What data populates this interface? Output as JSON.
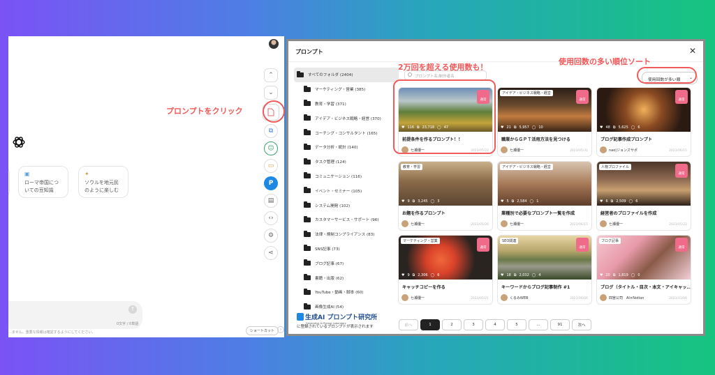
{
  "annotations": {
    "click_prompt": "プロンプトをクリック",
    "usage_count": "2万回を超える使用数も！",
    "sort": "使用回数の多い順位ソート"
  },
  "chat": {
    "suggestions": [
      {
        "label": "ローマ帝国につ\nいての豆知識"
      },
      {
        "label": "ソウルを地元民\nのように楽しむ"
      }
    ],
    "char_count": "0文字 / 0単語",
    "disclaimer": "...ません。重要な情報は確認するようにしてください。",
    "shortcut_label": "ショートカット"
  },
  "modal": {
    "title": "プロンプト",
    "search_placeholder": "プロンプト名/制作者名",
    "sort_value": "使用回数が多い順",
    "folders": [
      {
        "label": "すべてのフォルダ (2404)",
        "selected": true,
        "sub": false
      },
      {
        "label": "マーケティング・営業 (385)",
        "selected": false,
        "sub": true
      },
      {
        "label": "教育・学習 (371)",
        "selected": false,
        "sub": true
      },
      {
        "label": "アイデア・ビジネス戦略・経営 (370)",
        "selected": false,
        "sub": true
      },
      {
        "label": "コーチング・コンサルタント (165)",
        "selected": false,
        "sub": true
      },
      {
        "label": "データ分析・統計 (140)",
        "selected": false,
        "sub": true
      },
      {
        "label": "タスク管理 (124)",
        "selected": false,
        "sub": true
      },
      {
        "label": "コミュニケーション (116)",
        "selected": false,
        "sub": true
      },
      {
        "label": "イベント・セミナー (105)",
        "selected": false,
        "sub": true
      },
      {
        "label": "システム開発 (102)",
        "selected": false,
        "sub": true
      },
      {
        "label": "カスタマーサービス・サポート (96)",
        "selected": false,
        "sub": true
      },
      {
        "label": "法律・規制コンプライアンス (83)",
        "selected": false,
        "sub": true
      },
      {
        "label": "SNS記事 (73)",
        "selected": false,
        "sub": true
      },
      {
        "label": "ブログ記事 (67)",
        "selected": false,
        "sub": true
      },
      {
        "label": "書籍・出版 (62)",
        "selected": false,
        "sub": true
      },
      {
        "label": "YouTube・動画・脚本 (60)",
        "selected": false,
        "sub": true
      },
      {
        "label": "画像生成AI (54)",
        "selected": false,
        "sub": true
      }
    ],
    "lab_name": "生成AI プロンプト研究所",
    "lab_sub": "Generative AI Prompt Laboratory",
    "lab_note": "に登録されているプロンプトが表示されます",
    "cards": [
      {
        "tag": "",
        "badge": "通常",
        "likes": "116",
        "uses": "23,718",
        "comments": "47",
        "title": "前提条件を作るプロンプト！！",
        "author": "七瀬優一",
        "date": "2023/05/22",
        "bg": "linear-gradient(180deg,#6d8fb5 0%,#b9c7c9 30%,#5f7e3a 55%,#c3a43a 80%,#6b5a2a 100%)"
      },
      {
        "tag": "アイデア・ビジネス戦略・経営",
        "badge": "通常",
        "likes": "21",
        "uses": "5,957",
        "comments": "10",
        "title": "職業からＧＰＴ活用方法を見つける",
        "author": "七瀬優一",
        "date": "2023/05/31",
        "bg": "linear-gradient(180deg,#2b1d16 0%,#6a4a2f 40%,#c27b3e 65%,#3a2418 100%)"
      },
      {
        "tag": "",
        "badge": "通常",
        "likes": "48",
        "uses": "5,625",
        "comments": "6",
        "title": "ブログ記事作成プロンプト",
        "author": "nao|ジョンズサポ",
        "date": "2023/06/15",
        "bg": "radial-gradient(circle at 50% 50%,#f0b05a 0%,#8a4a22 35%,#2a1a12 75%)"
      },
      {
        "tag": "教育・学習",
        "badge": "",
        "likes": "9",
        "uses": "3,245",
        "comments": "3",
        "title": "お題を作るプロンプト",
        "author": "七瀬優一",
        "date": "2023/05/26",
        "bg": "linear-gradient(180deg,#c9b08a 0%,#8a6a48 45%,#5a4432 100%)"
      },
      {
        "tag": "アイデア・ビジネス戦略・経営",
        "badge": "",
        "likes": "5",
        "uses": "2,584",
        "comments": "1",
        "title": "業種別で必要なプロンプト一覧を作成",
        "author": "七瀬優一",
        "date": "2023/06/15",
        "bg": "linear-gradient(180deg,#d9c4b0 0%,#a77a58 50%,#5f3d2a 100%)"
      },
      {
        "tag": "人物プロファイル",
        "badge": "通常",
        "likes": "6",
        "uses": "2,509",
        "comments": "6",
        "title": "経営者のプロファイルを作成",
        "author": "七瀬優一",
        "date": "2023/05/22",
        "bg": "linear-gradient(180deg,#4a3428 0%,#8e6a52 40%,#c8a070 65%,#2e2018 100%)"
      },
      {
        "tag": "マーケティング・営業",
        "badge": "通常",
        "likes": "9",
        "uses": "2,306",
        "comments": "6",
        "title": "キャッチコピーを作る",
        "author": "七瀬優一",
        "date": "2023/05/21",
        "bg": "radial-gradient(circle at 45% 55%,#f0683a 0%,#d9422a 25%,#2a2420 60%)"
      },
      {
        "tag": "SEO関連",
        "badge": "通常",
        "likes": "18",
        "uses": "2,032",
        "comments": "4",
        "title": "キーワードからブログ記事制作 #1",
        "author": "くるみWEB",
        "date": "2023/06/06",
        "bg": "linear-gradient(180deg,#e8d6a6 0%,#b7a66a 35%,#6a7a4a 55%,#9a9a8a 70%,#3a4a2a 100%)"
      },
      {
        "tag": "ブログ記事",
        "badge": "通常",
        "likes": "20",
        "uses": "1,819",
        "comments": "0",
        "title": "ブログ（タイトル・目次・本文・アイキャッ...",
        "author": "四宮公司　AI×Notion",
        "date": "2023/11/06",
        "bg": "linear-gradient(135deg,#f4c8d0 0%,#e89aaa 35%,#8a5a48 60%,#f2d0d8 100%)"
      }
    ],
    "pagination": [
      "前へ",
      "1",
      "2",
      "3",
      "4",
      "5",
      "...",
      "91",
      "次へ"
    ]
  }
}
